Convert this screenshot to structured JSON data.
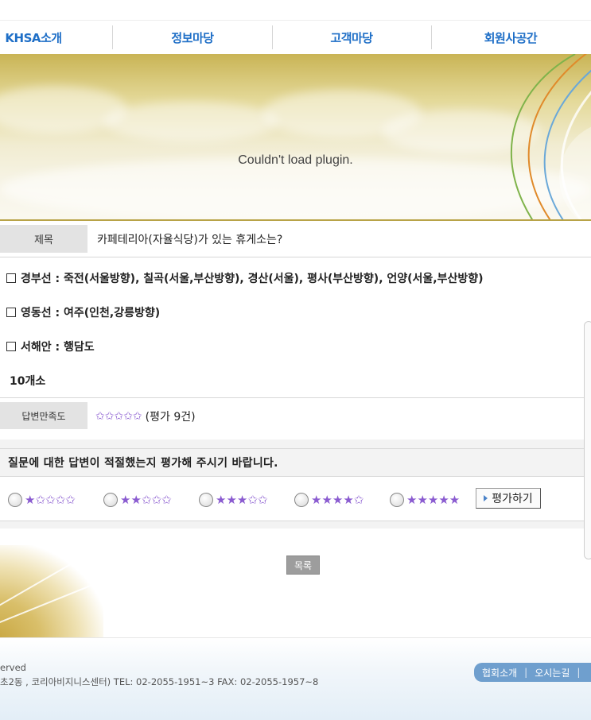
{
  "nav": {
    "items": [
      {
        "label": "KHSA소개"
      },
      {
        "label": "정보마당"
      },
      {
        "label": "고객마당"
      },
      {
        "label": "회원사공간"
      }
    ]
  },
  "banner": {
    "plugin_message": "Couldn't load plugin."
  },
  "question": {
    "title_label": "제목",
    "title": "카페테리아(자율식당)가 있는 휴게소는?"
  },
  "answer": {
    "lines": [
      "경부선 : 죽전(서울방향), 칠곡(서울,부산방향), 경산(서울), 평사(부산방향), 언양(서울,부산방향)",
      "영동선 : 여주(인천,강릉방향)",
      "서해안 : 행담도"
    ],
    "count": "10개소"
  },
  "satisfaction": {
    "label": "답변만족도",
    "stars": "✩✩✩✩✩",
    "text": "(평가 9건)"
  },
  "evaluation": {
    "question": "질문에 대한 답변이 적절했는지 평가해 주시기 바랍니다.",
    "options": [
      {
        "stars": "★✩✩✩✩"
      },
      {
        "stars": "★★✩✩✩"
      },
      {
        "stars": "★★★✩✩"
      },
      {
        "stars": "★★★★✩"
      },
      {
        "stars": "★★★★★"
      }
    ],
    "submit_label": "평가하기"
  },
  "list_button": "목록",
  "footer": {
    "line1": "erved",
    "line2": "초2동 , 코리아비지니스센터) TEL: 02-2055-1951~3 FAX: 02-2055-1957~8",
    "links": [
      "협회소개",
      "오시는길"
    ]
  },
  "colors": {
    "nav_text": "#1f6fc7",
    "star": "#8a5bd0",
    "footer_links_bg": "#6f9fce"
  }
}
